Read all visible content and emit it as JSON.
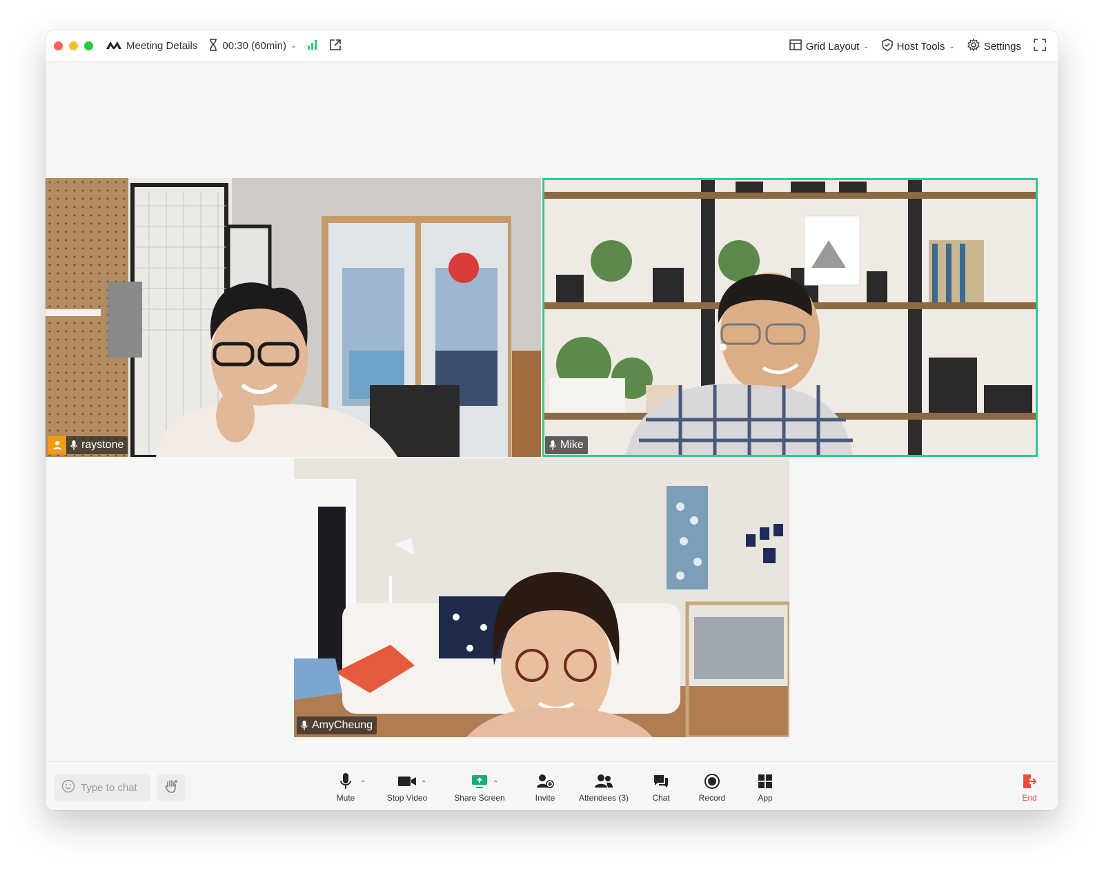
{
  "titlebar": {
    "meeting_details": "Meeting Details",
    "timer": "00:30 (60min)",
    "grid_layout": "Grid Layout",
    "host_tools": "Host Tools",
    "settings": "Settings"
  },
  "participants": [
    {
      "name": "raystone",
      "is_host": true,
      "active_speaker": false
    },
    {
      "name": "Mike",
      "is_host": false,
      "active_speaker": true
    },
    {
      "name": "AmyCheung",
      "is_host": false,
      "active_speaker": false
    }
  ],
  "toolbar": {
    "chat_placeholder": "Type to chat",
    "mute": "Mute",
    "stop_video": "Stop Video",
    "share_screen": "Share Screen",
    "invite": "Invite",
    "attendees": "Attendees (3)",
    "chat": "Chat",
    "record": "Record",
    "app": "App",
    "end": "End"
  },
  "colors": {
    "active_speaker_border": "#2ecc8f",
    "host_badge": "#f39c12",
    "end_red": "#e74c3c",
    "signal_green": "#2ecc71"
  }
}
